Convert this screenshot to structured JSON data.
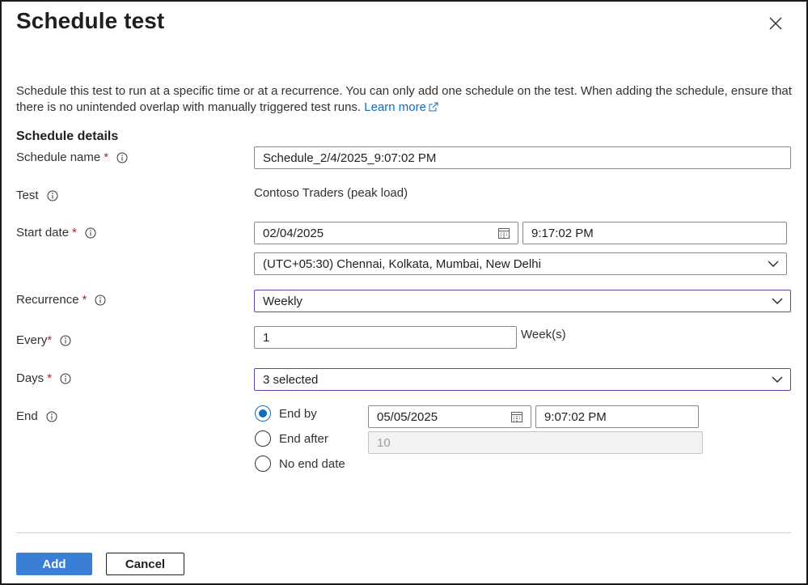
{
  "dialog": {
    "title": "Schedule test",
    "description": "Schedule this test to run at a specific time or at a recurrence. You can only add one schedule on the test. When adding the schedule, ensure that there is no unintended overlap with manually triggered test runs.",
    "learn_more": "Learn more"
  },
  "section": {
    "title": "Schedule details"
  },
  "fields": {
    "schedule_name": {
      "label": "Schedule name",
      "required": "*",
      "value": "Schedule_2/4/2025_9:07:02 PM"
    },
    "test": {
      "label": "Test",
      "value": "Contoso Traders (peak load)"
    },
    "start_date": {
      "label": "Start date",
      "required": "*",
      "date": "02/04/2025",
      "time": "9:17:02 PM",
      "timezone": "(UTC+05:30) Chennai, Kolkata, Mumbai, New Delhi"
    },
    "recurrence": {
      "label": "Recurrence",
      "required": "*",
      "value": "Weekly"
    },
    "every": {
      "label": "Every",
      "required": "*",
      "value": "1",
      "unit": "Week(s)"
    },
    "days": {
      "label": "Days",
      "required": "*",
      "value": "3 selected"
    },
    "end": {
      "label": "End",
      "options": {
        "end_by": "End by",
        "end_after": "End after",
        "no_end_date": "No end date"
      },
      "selected": "end_by",
      "end_by_date": "05/05/2025",
      "end_by_time": "9:07:02 PM",
      "end_after_value": "10"
    }
  },
  "footer": {
    "add_label": "Add",
    "cancel_label": "Cancel"
  },
  "colors": {
    "accent": "#0f6cbd",
    "primary_button": "#3a7fd5",
    "required": "#a4262c",
    "focus_border": "#6b3fa0"
  }
}
